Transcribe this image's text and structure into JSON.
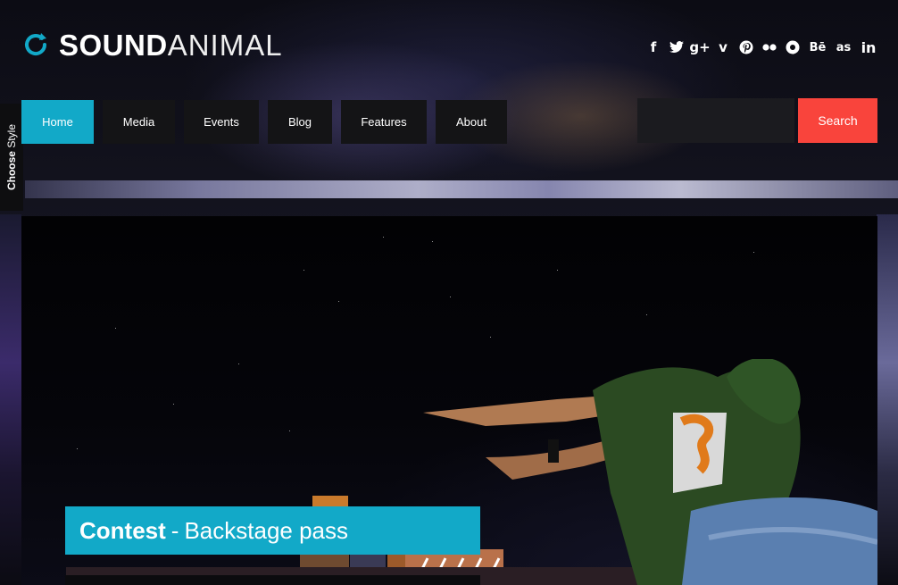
{
  "brand": {
    "bold": "SOUND",
    "light": "ANIMAL",
    "accent_color": "#12a9c8"
  },
  "social": [
    {
      "icon": "facebook-icon",
      "glyph": "f"
    },
    {
      "icon": "twitter-icon",
      "glyph": "🐦"
    },
    {
      "icon": "google-plus-icon",
      "glyph": "g+"
    },
    {
      "icon": "vimeo-icon",
      "glyph": "v"
    },
    {
      "icon": "pinterest-icon",
      "glyph": "℗"
    },
    {
      "icon": "flickr-icon",
      "glyph": "••"
    },
    {
      "icon": "picasa-icon",
      "glyph": "✪"
    },
    {
      "icon": "behance-icon",
      "glyph": "Bē"
    },
    {
      "icon": "lastfm-icon",
      "glyph": "as"
    },
    {
      "icon": "linkedin-icon",
      "glyph": "in"
    }
  ],
  "nav": {
    "items": [
      "Home",
      "Media",
      "Events",
      "Blog",
      "Features",
      "About"
    ],
    "active": "Home"
  },
  "search": {
    "placeholder": "",
    "button_label": "Search",
    "button_color": "#f9443c"
  },
  "side_tab": {
    "bold": "Choose",
    "light": "Style"
  },
  "hero": {
    "caption_title": "Contest",
    "caption_separator": "-",
    "caption_subtitle": "Backstage pass"
  }
}
